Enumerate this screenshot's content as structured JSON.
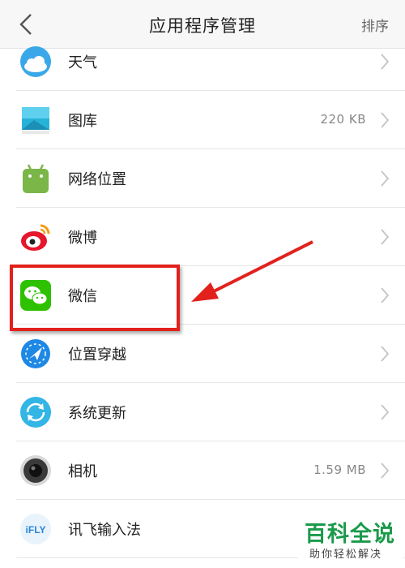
{
  "header": {
    "title": "应用程序管理",
    "sort_label": "排序",
    "back_icon": "chevron-left-icon"
  },
  "apps": [
    {
      "name": "天气",
      "size": "",
      "icon": "weather-icon"
    },
    {
      "name": "图库",
      "size": "220 KB",
      "icon": "gallery-icon"
    },
    {
      "name": "网络位置",
      "size": "",
      "icon": "android-icon"
    },
    {
      "name": "微博",
      "size": "",
      "icon": "weibo-icon"
    },
    {
      "name": "微信",
      "size": "",
      "icon": "wechat-icon"
    },
    {
      "name": "位置穿越",
      "size": "",
      "icon": "location-icon"
    },
    {
      "name": "系统更新",
      "size": "",
      "icon": "system-update-icon"
    },
    {
      "name": "相机",
      "size": "1.59 MB",
      "icon": "camera-icon"
    },
    {
      "name": "讯飞输入法",
      "size": "",
      "icon": "ifly-icon"
    }
  ],
  "ifly_icon_text": "iFLY",
  "watermark": {
    "title": "百科全说",
    "subtitle": "助你轻松解决"
  },
  "colors": {
    "highlight": "#e2211c",
    "watermark_green": "#1a9a4a",
    "wechat_green": "#2dc100"
  }
}
